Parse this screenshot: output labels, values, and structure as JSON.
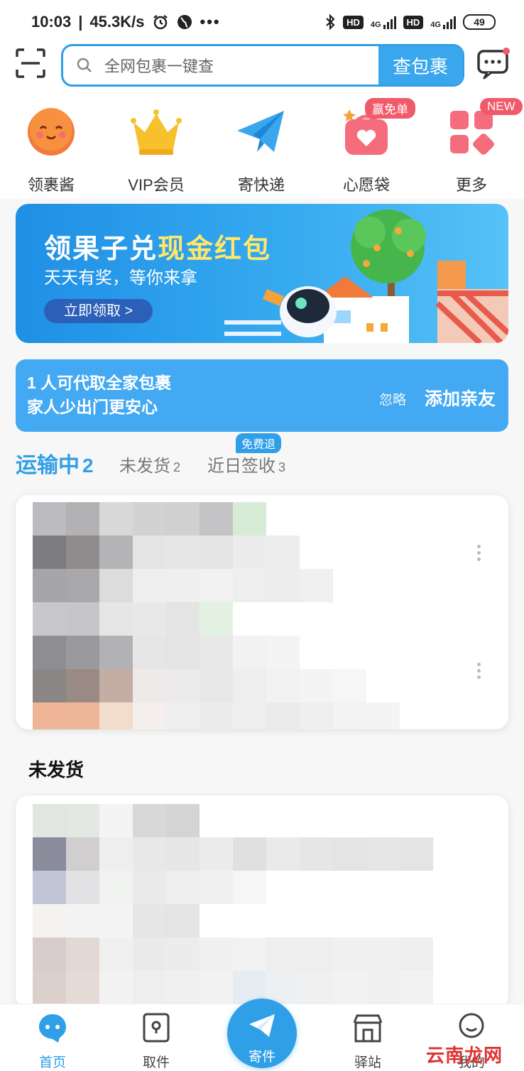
{
  "status_bar": {
    "time": "10:03",
    "speed": "45.3K/s",
    "hd1": "HD",
    "net1": "4G",
    "hd2": "HD",
    "net2": "4G",
    "battery": "49"
  },
  "header": {
    "search_placeholder": "全网包裹一键查",
    "search_button": "查包裹",
    "icons": [
      "scan-icon",
      "message-icon"
    ]
  },
  "quick_menu": {
    "items": [
      {
        "label": "领裹酱",
        "icon": "mascot-icon"
      },
      {
        "label": "VIP会员",
        "icon": "crown-icon"
      },
      {
        "label": "寄快递",
        "icon": "paper-plane-icon"
      },
      {
        "label": "心愿袋",
        "icon": "wish-bag-icon",
        "badge": "赢免单"
      },
      {
        "label": "更多",
        "icon": "more-grid-icon",
        "badge": "NEW"
      }
    ]
  },
  "banner": {
    "title_prefix": "领果子兑",
    "title_highlight": "现金红包",
    "subtitle": "天天有奖，等你来拿",
    "cta": "立即领取 >"
  },
  "family_notice": {
    "line1": "1 人可代取全家包裹",
    "line2": "家人少出门更安心",
    "ignore": "忽略",
    "add": "添加亲友"
  },
  "package_tabs": {
    "free_return_badge": "免费退",
    "tabs": [
      {
        "label": "运输中",
        "count": "2"
      },
      {
        "label": "未发货",
        "count": "2"
      },
      {
        "label": "近日签收",
        "count": "3"
      }
    ]
  },
  "sections": {
    "unshipped_title": "未发货"
  },
  "bottom_nav": {
    "items": [
      {
        "label": "首页"
      },
      {
        "label": "取件"
      },
      {
        "label": "寄件"
      },
      {
        "label": "驿站"
      },
      {
        "label": "我的"
      }
    ]
  },
  "watermark": "云南龙网",
  "colors": {
    "accent": "#2f9fe8",
    "badge_red": "#f05a6a"
  }
}
